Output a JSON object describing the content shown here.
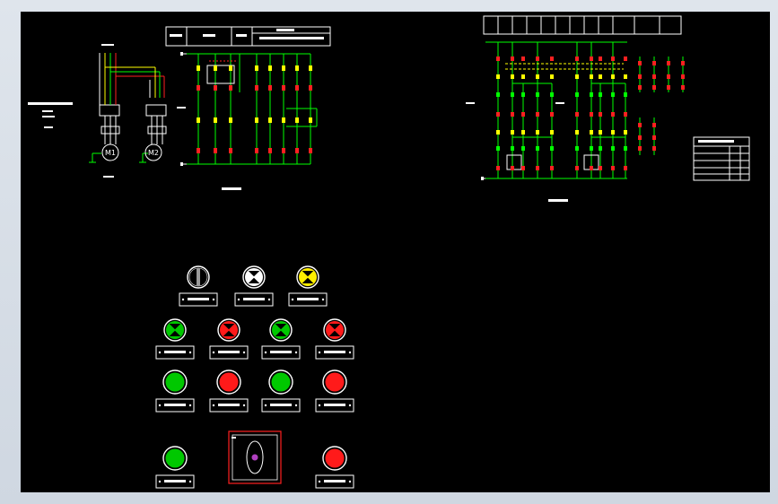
{
  "colors": {
    "background": "#000000",
    "wire_white": "#ffffff",
    "wire_green": "#00ff00",
    "wire_red": "#ff2020",
    "wire_yellow": "#ffff00",
    "lamp_green": "#00c800",
    "lamp_red": "#ff1a1a",
    "lamp_yellow": "#ffee00",
    "selector_purple": "#b040c0"
  },
  "motors": [
    {
      "label": "M1"
    },
    {
      "label": "M2"
    }
  ],
  "lamps": [
    {
      "type": "selector",
      "color_key": "wire_white"
    },
    {
      "type": "indicator",
      "color_key": "wire_white"
    },
    {
      "type": "indicator",
      "color_key": "lamp_yellow"
    },
    {
      "type": "indicator",
      "color_key": "lamp_green"
    },
    {
      "type": "indicator",
      "color_key": "lamp_red"
    },
    {
      "type": "indicator",
      "color_key": "lamp_green"
    },
    {
      "type": "indicator",
      "color_key": "lamp_red"
    }
  ],
  "buttons": [
    {
      "color_key": "lamp_green"
    },
    {
      "color_key": "lamp_red"
    },
    {
      "color_key": "lamp_green"
    },
    {
      "color_key": "lamp_red"
    },
    {
      "color_key": "lamp_green"
    },
    {
      "color_key": "lamp_red"
    }
  ],
  "icons": [
    "motor-symbol-icon",
    "indicator-lamp-icon",
    "push-button-icon",
    "selector-switch-icon",
    "emergency-stop-icon"
  ]
}
